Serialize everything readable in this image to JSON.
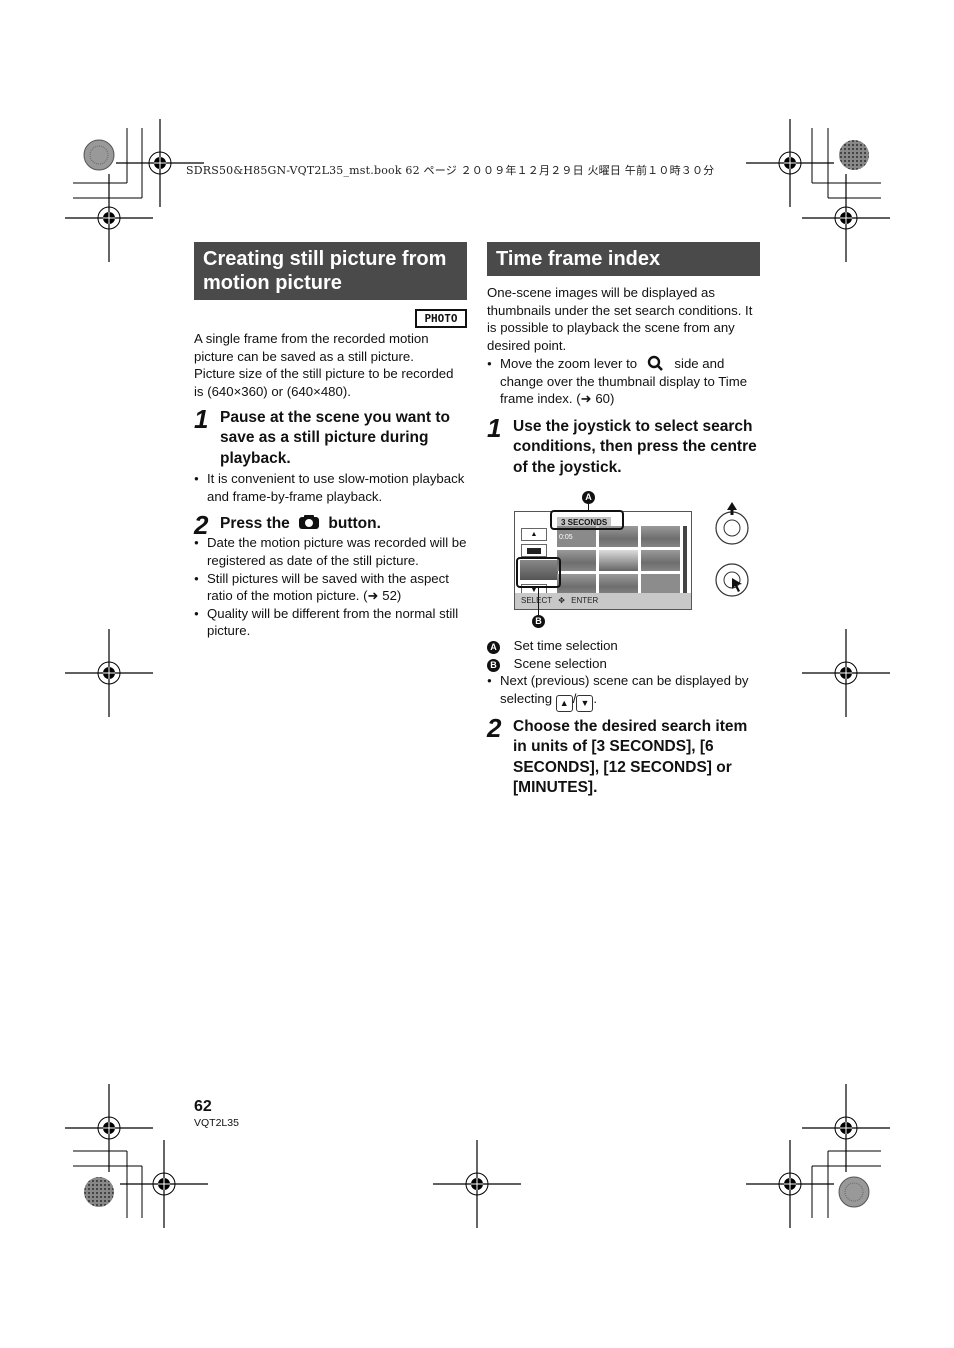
{
  "print_header": "SDRS50&H85GN-VQT2L35_mst.book  62 ページ  ２００９年１２月２９日  火曜日  午前１０時３０分",
  "left_section": {
    "title": "Creating still picture from motion picture",
    "mode_badge": "PHOTO",
    "intro": [
      "A single frame from the recorded motion",
      "picture can be saved as a still picture.",
      "Picture size of the still picture to be recorded",
      "is (640×360) or (640×480)."
    ],
    "steps": [
      {
        "number": "1",
        "text": "Pause at the scene you want to save as a still picture during playback.",
        "bullets": [
          "It is convenient to use slow-motion playback and frame-by-frame playback."
        ]
      },
      {
        "number": "2",
        "text_before": "Press the",
        "icon": "camera-icon",
        "text_after": "button.",
        "bullets": [
          "Date the motion picture was recorded will be registered as date of the still picture.",
          "Still pictures will be saved with the aspect ratio of the motion picture. (➜ 52)",
          "Quality will be different from the normal still picture."
        ]
      }
    ]
  },
  "right_section": {
    "title": "Time frame index",
    "intro": "One-scene images will be displayed as thumbnails under the set search conditions. It is possible to playback the scene from any desired point.",
    "bullet_before": "Move the zoom lever to",
    "bullet_icon": "zoom-magnifier-icon",
    "bullet_after": "side and change over the thumbnail display to Time frame index. (➜ 60)",
    "steps": [
      {
        "number": "1",
        "text": "Use the joystick to select search conditions, then press the centre of the joystick."
      },
      {
        "number": "2",
        "text": "Choose the desired search item in units of [3 SECONDS], [6 SECONDS], [12 SECONDS] or [MINUTES]."
      }
    ],
    "diagram": {
      "time_label": "3 SECONDS",
      "top_left_label": "0:05",
      "bottom_bar_select": "SELECT",
      "bottom_bar_enter": "ENTER",
      "up_button": "▲",
      "down_button": "▼",
      "callout_a": "A",
      "callout_b": "B"
    },
    "legend": [
      {
        "marker": "A",
        "text": "Set time selection"
      },
      {
        "marker": "B",
        "text": "Scene selection"
      }
    ],
    "note_before": "Next (previous) scene can be displayed by selecting",
    "note_up": "▲",
    "note_sep": "/",
    "note_down": "▼",
    "note_end": "."
  },
  "footer": {
    "page_number": "62",
    "doc_code": "VQT2L35"
  }
}
